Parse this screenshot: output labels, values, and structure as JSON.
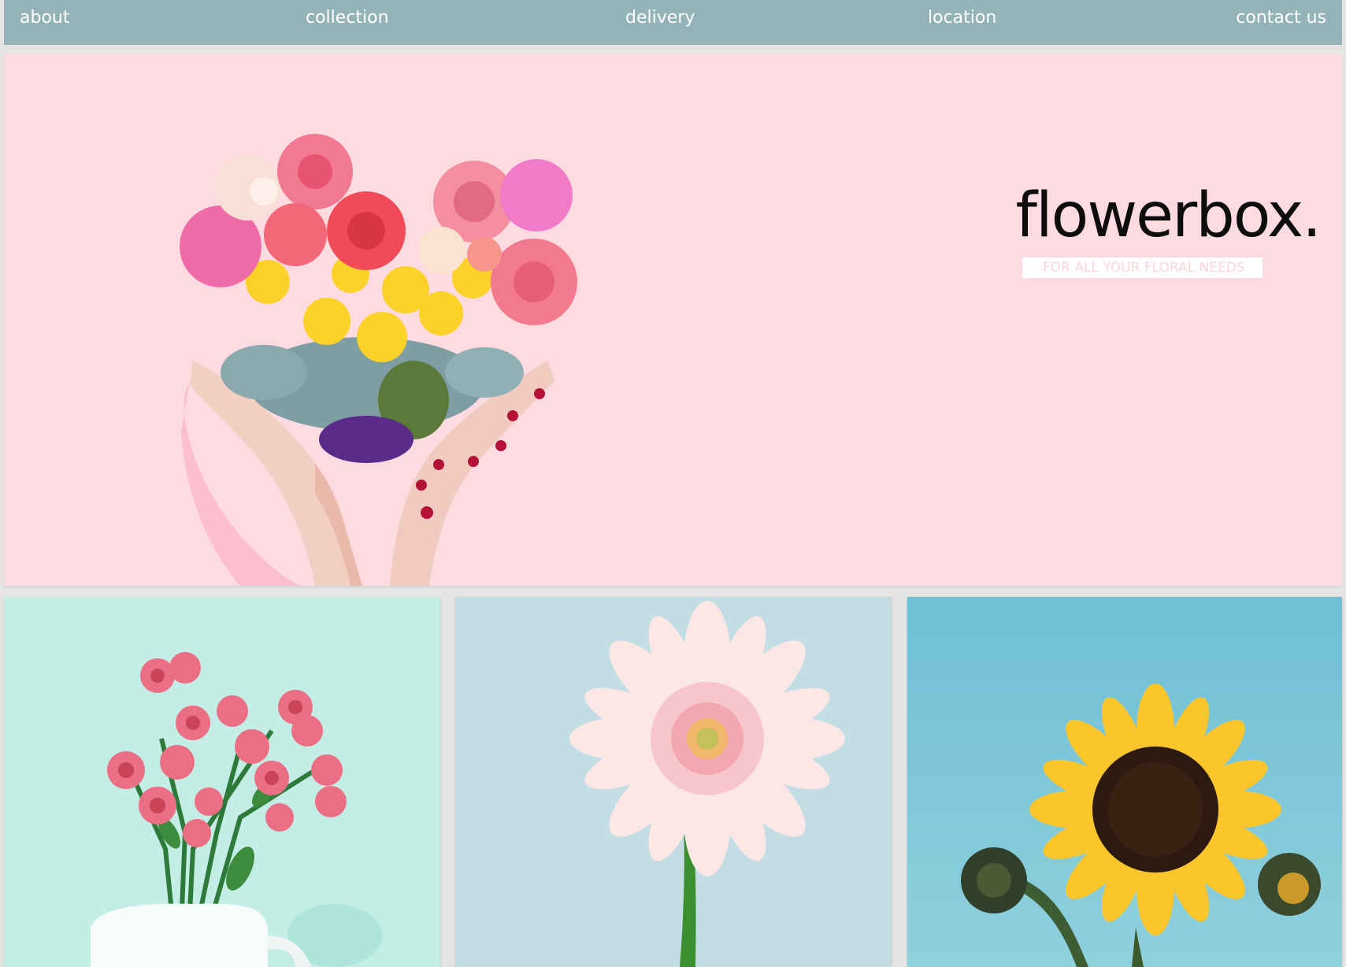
{
  "nav": {
    "items": [
      {
        "label": "about"
      },
      {
        "label": "collection"
      },
      {
        "label": "delivery"
      },
      {
        "label": "location"
      },
      {
        "label": "contact us"
      }
    ],
    "background": "#93b3b9"
  },
  "hero": {
    "brand": "flowerbox.",
    "tagline": "FOR ALL YOUR FLORAL NEEDS",
    "background": "#fedbe0",
    "image_icon": "heart-bouquet-in-hands"
  },
  "gallery": [
    {
      "icon": "pink-roses-in-vase",
      "background": "#c4ede6"
    },
    {
      "icon": "pink-gerbera-daisy",
      "background": "#c2dde3"
    },
    {
      "icon": "sunflower",
      "background": "#78c4d7"
    }
  ],
  "colors": {
    "page_background": "#e7e5e4",
    "brand_text": "#0d0d0d",
    "tagline_text": "#fbd6dc"
  }
}
